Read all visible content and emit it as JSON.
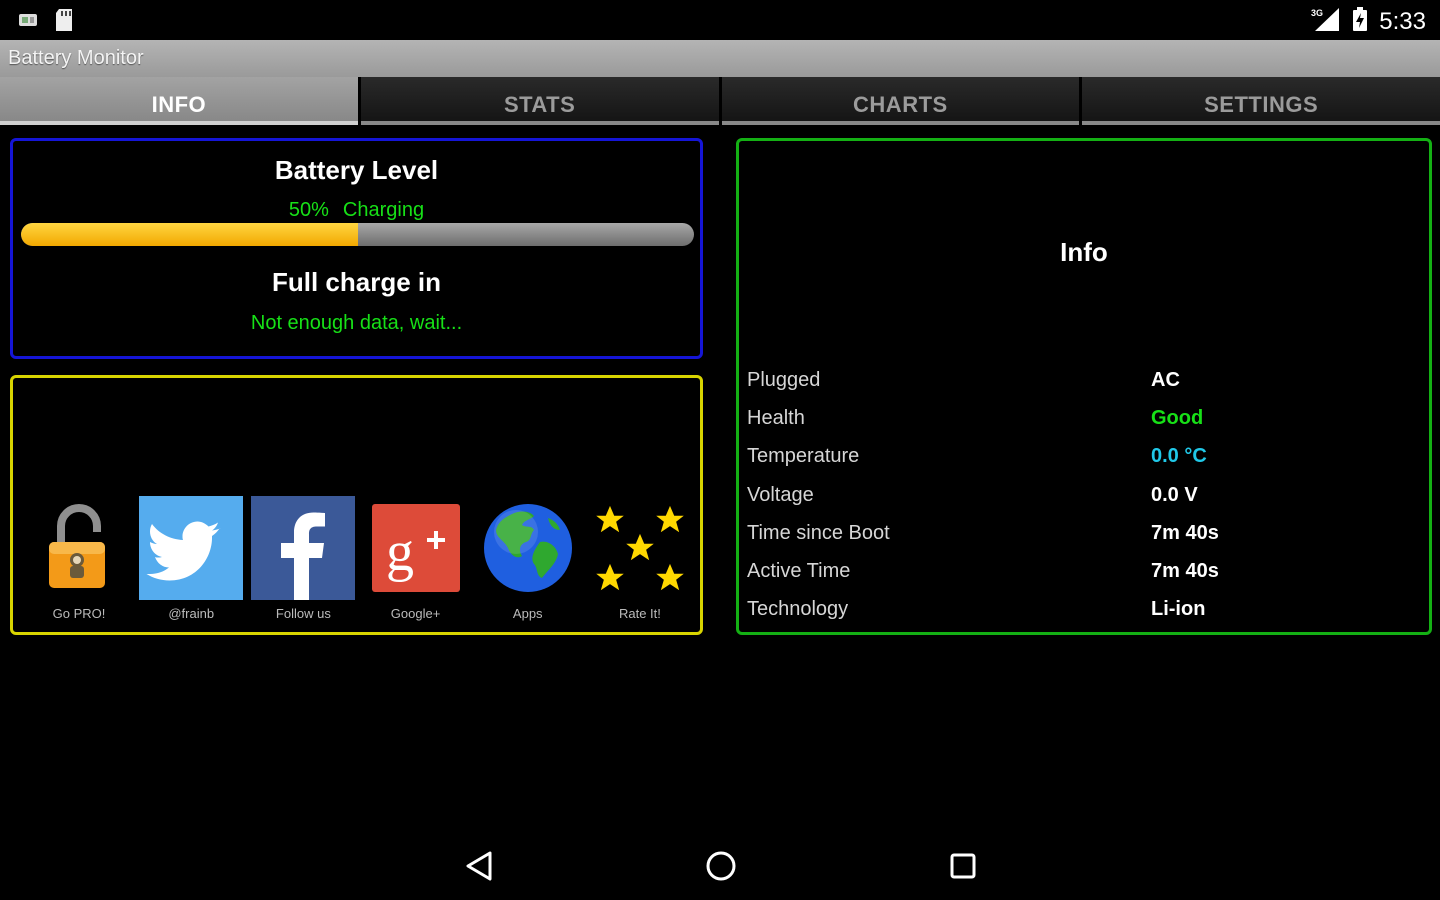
{
  "status_bar": {
    "time": "5:33",
    "left_icons": [
      "notification-app-icon",
      "sd-card-icon"
    ],
    "right_icons": [
      "signal-icon",
      "battery-charging-icon"
    ],
    "network_label": "3G"
  },
  "app": {
    "title": "Battery Monitor"
  },
  "tabs": [
    {
      "label": "INFO",
      "active": true
    },
    {
      "label": "STATS",
      "active": false
    },
    {
      "label": "CHARTS",
      "active": false
    },
    {
      "label": "SETTINGS",
      "active": false
    }
  ],
  "battery": {
    "title": "Battery Level",
    "percent_text": "50%",
    "state": "Charging",
    "level_fraction": 0.5,
    "full_charge_title": "Full charge in",
    "full_charge_value": "Not enough data, wait..."
  },
  "links": [
    {
      "label": "Go PRO!",
      "icon": "padlock-icon"
    },
    {
      "label": "@frainb",
      "icon": "twitter-icon"
    },
    {
      "label": "Follow us",
      "icon": "facebook-icon"
    },
    {
      "label": "Google+",
      "icon": "google-plus-icon"
    },
    {
      "label": "Apps",
      "icon": "globe-icon"
    },
    {
      "label": "Rate It!",
      "icon": "stars-icon"
    }
  ],
  "info": {
    "title": "Info",
    "rows": [
      {
        "key": "Plugged",
        "value": "AC",
        "color": "#ffffff"
      },
      {
        "key": "Health",
        "value": "Good",
        "color": "#17e017"
      },
      {
        "key": "Temperature",
        "value": "0.0 °C",
        "color": "#20c8e8"
      },
      {
        "key": "Voltage",
        "value": "0.0 V",
        "color": "#ffffff"
      },
      {
        "key": "Time since Boot",
        "value": "7m 40s",
        "color": "#ffffff"
      },
      {
        "key": "Active Time",
        "value": "7m 40s",
        "color": "#ffffff"
      },
      {
        "key": "Technology",
        "value": "Li-ion",
        "color": "#ffffff"
      }
    ]
  },
  "colors": {
    "battery_panel_border": "#1515d6",
    "links_panel_border": "#d8d400",
    "info_panel_border": "#14b014",
    "accent_green": "#17e017",
    "progress_fill": "#f2b000"
  },
  "nav_bar": {
    "icons": [
      "back-icon",
      "home-icon",
      "recents-icon"
    ]
  }
}
